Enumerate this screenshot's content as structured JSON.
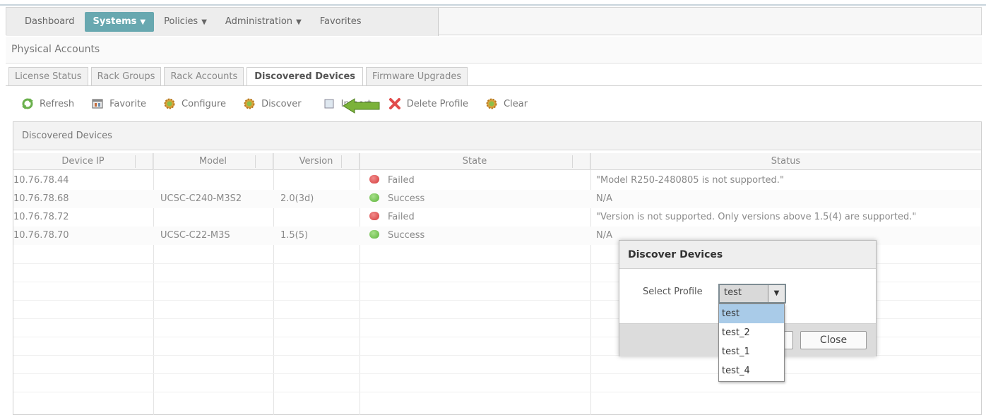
{
  "nav": {
    "items": [
      {
        "label": "Dashboard",
        "caret": false,
        "active": false
      },
      {
        "label": "Systems",
        "caret": true,
        "active": true
      },
      {
        "label": "Policies",
        "caret": true,
        "active": false
      },
      {
        "label": "Administration",
        "caret": true,
        "active": false
      },
      {
        "label": "Favorites",
        "caret": false,
        "active": false
      }
    ]
  },
  "page_title": "Physical Accounts",
  "tabs": [
    {
      "label": "License Status"
    },
    {
      "label": "Rack Groups"
    },
    {
      "label": "Rack Accounts"
    },
    {
      "label": "Discovered Devices"
    },
    {
      "label": "Firmware Upgrades"
    }
  ],
  "active_tab": "Discovered Devices",
  "toolbar": {
    "refresh": "Refresh",
    "favorite": "Favorite",
    "configure": "Configure",
    "discover": "Discover",
    "import": "Import",
    "delete_profile": "Delete Profile",
    "clear": "Clear"
  },
  "panel_title": "Discovered Devices",
  "table": {
    "columns": [
      "Device IP",
      "Model",
      "Version",
      "State",
      "Status"
    ],
    "rows": [
      {
        "ip": "10.76.78.44",
        "model": "",
        "version": "",
        "state": "Failed",
        "status": "\"Model R250-2480805 is not supported.\""
      },
      {
        "ip": "10.76.78.68",
        "model": "UCSC-C240-M3S2",
        "version": "2.0(3d)",
        "state": "Success",
        "status": "N/A"
      },
      {
        "ip": "10.76.78.72",
        "model": "",
        "version": "",
        "state": "Failed",
        "status": "\"Version  is not supported. Only versions above 1.5(4) are supported.\""
      },
      {
        "ip": "10.76.78.70",
        "model": "UCSC-C22-M3S",
        "version": "1.5(5)",
        "state": "Success",
        "status": "N/A"
      }
    ]
  },
  "dialog": {
    "title": "Discover Devices",
    "select_label": "Select Profile",
    "selected": "test",
    "options": [
      "test",
      "test_2",
      "test_1",
      "test_4"
    ],
    "close_label": "Close"
  },
  "colors": {
    "nav_active": "#68a8b0",
    "failed": "#d33a3a",
    "success": "#5db33a",
    "arrow": "#7bb23a",
    "dropdown_highlight": "#a9cbe8"
  },
  "icons": {
    "refresh": "refresh-icon",
    "favorite": "favorite-icon",
    "configure": "gear-icon",
    "discover": "gear-icon",
    "import": "import-icon",
    "delete_profile": "delete-x-icon",
    "clear": "gear-icon",
    "annotation": "green-arrow-icon"
  }
}
